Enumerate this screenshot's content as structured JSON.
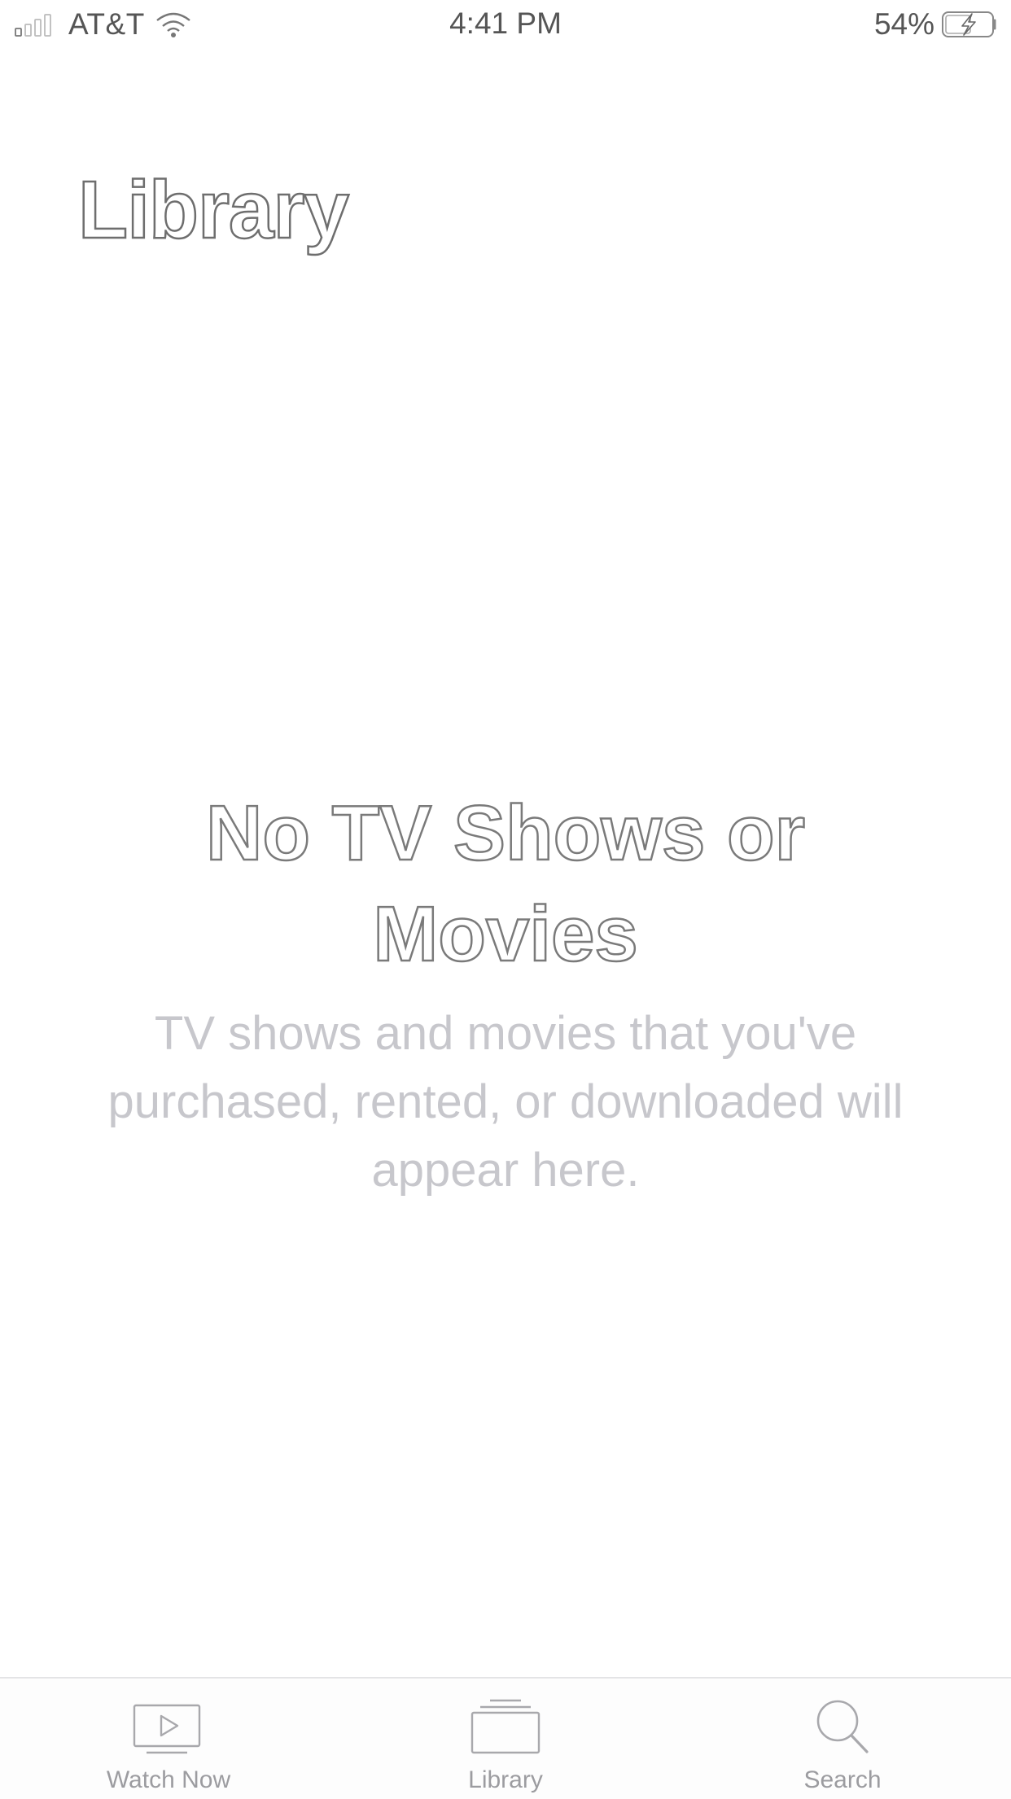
{
  "status_bar": {
    "carrier": "AT&T",
    "time": "4:41 PM",
    "battery_percent": "54%",
    "signal_icon": "signal-bars-icon",
    "wifi_icon": "wifi-icon",
    "battery_icon": "battery-charging-icon"
  },
  "header": {
    "title": "Library"
  },
  "empty_state": {
    "heading": "No TV Shows or Movies",
    "body": "TV shows and movies that you've purchased, rented, or downloaded will appear here."
  },
  "tab_bar": {
    "tabs": [
      {
        "label": "Watch Now",
        "icon": "play-screen-icon"
      },
      {
        "label": "Library",
        "icon": "stacked-library-icon"
      },
      {
        "label": "Search",
        "icon": "search-icon"
      }
    ]
  },
  "colors": {
    "background": "#ffffff",
    "secondary_text": "#c7c7cc",
    "tab_inactive": "#9c9ca0",
    "divider": "#e4e4e6"
  }
}
